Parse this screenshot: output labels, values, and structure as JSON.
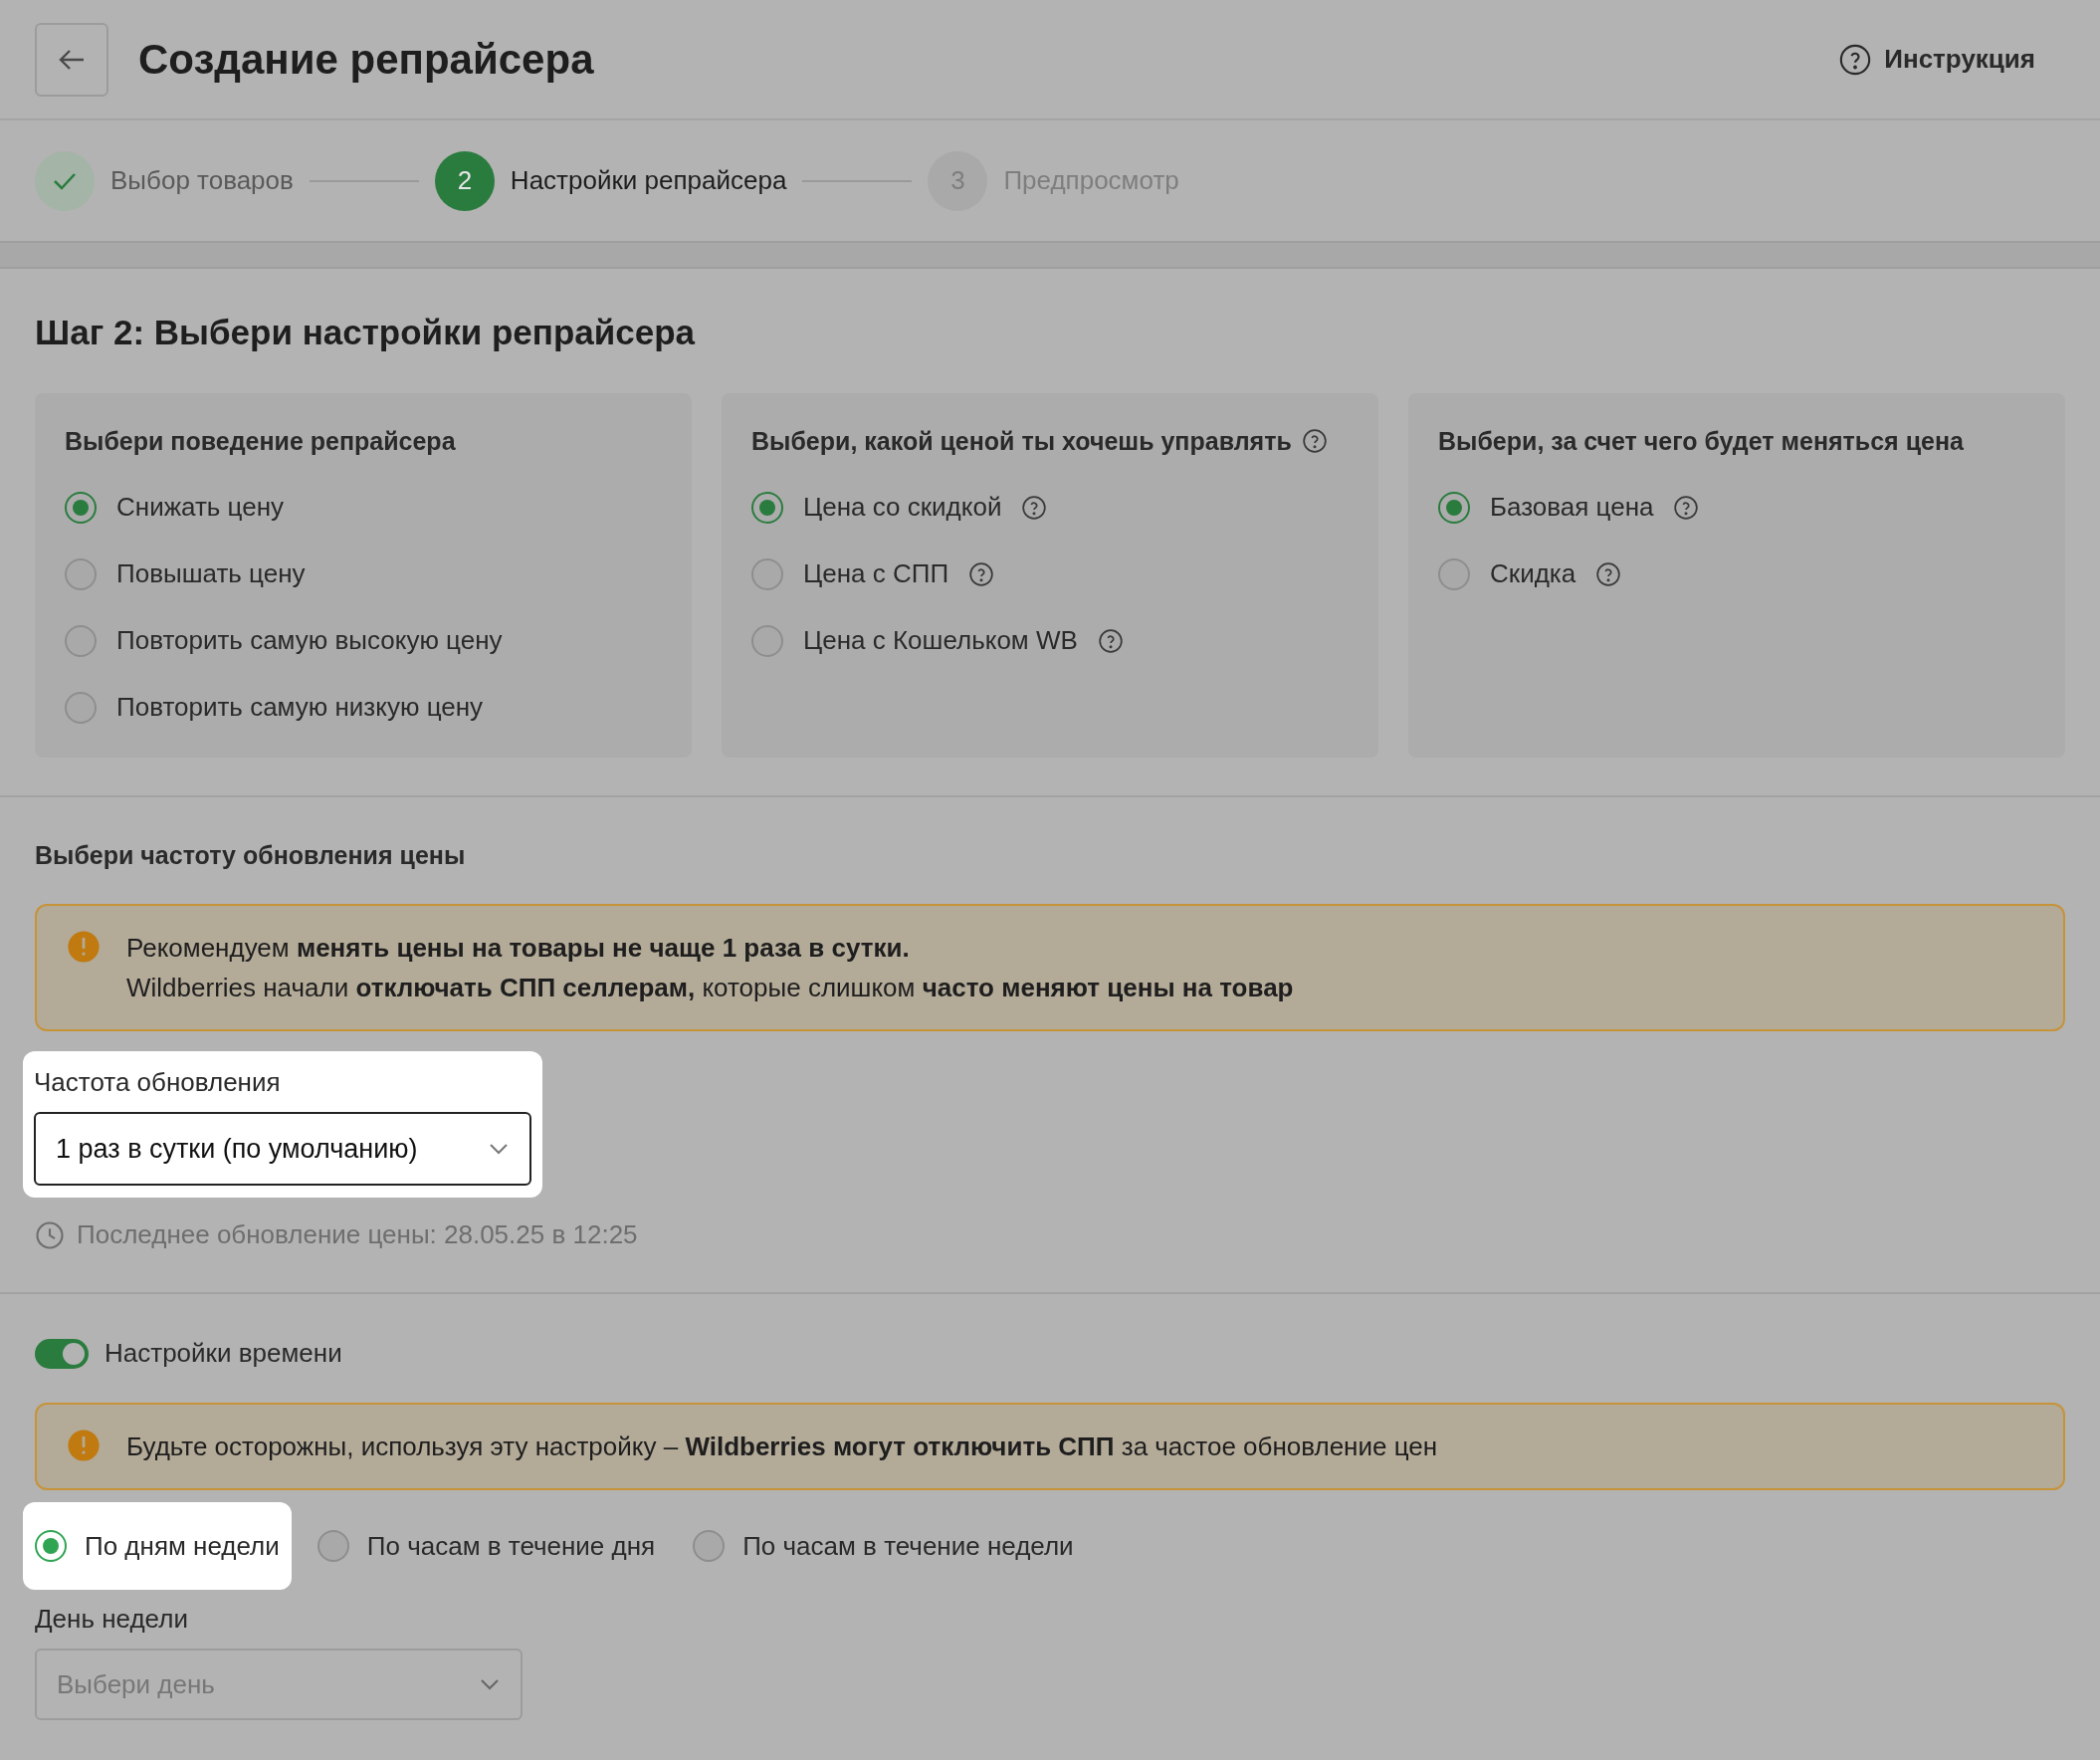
{
  "header": {
    "title": "Создание репрайсера",
    "help_link": "Инструкция"
  },
  "steps": [
    {
      "kind": "done",
      "label": "Выбор товаров"
    },
    {
      "kind": "current",
      "number": "2",
      "label": "Настройки репрайсера"
    },
    {
      "kind": "upcoming",
      "number": "3",
      "label": "Предпросмотр"
    }
  ],
  "heading": "Шаг 2: Выбери настройки репрайсера",
  "cards": [
    {
      "title": "Выбери поведение репрайсера",
      "help": false,
      "options": [
        {
          "label": "Снижать цену",
          "selected": true,
          "help": false
        },
        {
          "label": "Повышать цену",
          "selected": false,
          "help": false
        },
        {
          "label": "Повторить самую высокую цену",
          "selected": false,
          "help": false
        },
        {
          "label": "Повторить самую низкую цену",
          "selected": false,
          "help": false
        }
      ]
    },
    {
      "title": "Выбери, какой ценой ты хочешь управлять",
      "help": true,
      "options": [
        {
          "label": "Цена со скидкой",
          "selected": true,
          "help": true
        },
        {
          "label": "Цена с СПП",
          "selected": false,
          "help": true
        },
        {
          "label": "Цена с Кошельком WB",
          "selected": false,
          "help": true
        }
      ]
    },
    {
      "title": "Выбери, за счет чего будет меняться цена",
      "help": false,
      "options": [
        {
          "label": "Базовая цена",
          "selected": true,
          "help": true
        },
        {
          "label": "Скидка",
          "selected": false,
          "help": true
        }
      ]
    }
  ],
  "frequency": {
    "title": "Выбери частоту обновления цены",
    "alert": [
      "Рекомендуем **менять цены на товары не чаще 1 раза в сутки.**",
      "Wildberries начали **отключать СПП селлерам,** которые слишком **часто меняют цены на товар**"
    ],
    "select": {
      "label": "Частота обновления",
      "value": "1 раз в сутки (по умолчанию)",
      "highlighted": true
    },
    "last_update": "Последнее обновление цены: 28.05.25 в 12:25"
  },
  "time_settings": {
    "toggle": {
      "label": "Настройки времени",
      "on": true
    },
    "alert": [
      "Будьте осторожны, используя эту настройку – **Wildberries могут отключить СПП** за частое обновление цен"
    ],
    "modes": [
      {
        "label": "По дням недели",
        "selected": true,
        "highlighted": true
      },
      {
        "label": "По часам в течение дня",
        "selected": false,
        "highlighted": false
      },
      {
        "label": "По часам в течение недели",
        "selected": false,
        "highlighted": false
      }
    ],
    "day": {
      "label": "День недели",
      "placeholder": "Выбери день"
    }
  }
}
